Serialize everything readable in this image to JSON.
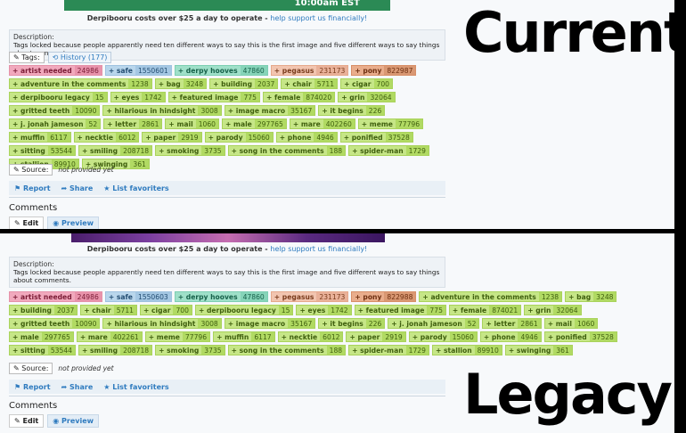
{
  "labels": {
    "current": "Current",
    "legacy": "Legacy"
  },
  "banner_text": "10:00am EST",
  "funding": {
    "prefix": "Derpibooru costs over $25 a day to operate - ",
    "link": "help support us financially!"
  },
  "description": {
    "title": "Description:",
    "text": "Tags locked because people apparently need ten different ways to say this is the first image and five different ways to say things about comments."
  },
  "tags_header": {
    "label": "Tags:",
    "history": "History (177)"
  },
  "current_tags": [
    {
      "name": "artist needed",
      "count": "24986",
      "kind": "pink"
    },
    {
      "name": "safe",
      "count": "1550601",
      "kind": "blue"
    },
    {
      "name": "derpy hooves",
      "count": "47860",
      "kind": "teal"
    },
    {
      "name": "pegasus",
      "count": "231173",
      "kind": "salmon"
    },
    {
      "name": "pony",
      "count": "822987",
      "kind": "brown"
    },
    {
      "name": "adventure in the comments",
      "count": "1238",
      "kind": "green"
    },
    {
      "name": "bag",
      "count": "3248",
      "kind": "green"
    },
    {
      "name": "building",
      "count": "2037",
      "kind": "green"
    },
    {
      "name": "chair",
      "count": "5711",
      "kind": "green"
    },
    {
      "name": "cigar",
      "count": "700",
      "kind": "green"
    },
    {
      "name": "derpibooru legacy",
      "count": "15",
      "kind": "green"
    },
    {
      "name": "eyes",
      "count": "1742",
      "kind": "green"
    },
    {
      "name": "featured image",
      "count": "775",
      "kind": "green"
    },
    {
      "name": "female",
      "count": "874020",
      "kind": "green"
    },
    {
      "name": "grin",
      "count": "32064",
      "kind": "green"
    },
    {
      "name": "gritted teeth",
      "count": "10090",
      "kind": "green"
    },
    {
      "name": "hilarious in hindsight",
      "count": "3008",
      "kind": "green"
    },
    {
      "name": "image macro",
      "count": "35167",
      "kind": "green"
    },
    {
      "name": "it begins",
      "count": "226",
      "kind": "green"
    },
    {
      "name": "j. jonah jameson",
      "count": "52",
      "kind": "green"
    },
    {
      "name": "letter",
      "count": "2861",
      "kind": "green"
    },
    {
      "name": "mail",
      "count": "1060",
      "kind": "green"
    },
    {
      "name": "male",
      "count": "297765",
      "kind": "green"
    },
    {
      "name": "mare",
      "count": "402260",
      "kind": "green"
    },
    {
      "name": "meme",
      "count": "77796",
      "kind": "green"
    },
    {
      "name": "muffin",
      "count": "6117",
      "kind": "green"
    },
    {
      "name": "necktie",
      "count": "6012",
      "kind": "green"
    },
    {
      "name": "paper",
      "count": "2919",
      "kind": "green"
    },
    {
      "name": "parody",
      "count": "15060",
      "kind": "green"
    },
    {
      "name": "phone",
      "count": "4946",
      "kind": "green"
    },
    {
      "name": "ponified",
      "count": "37528",
      "kind": "green"
    },
    {
      "name": "sitting",
      "count": "53544",
      "kind": "green"
    },
    {
      "name": "smiling",
      "count": "208718",
      "kind": "green"
    },
    {
      "name": "smoking",
      "count": "3735",
      "kind": "green"
    },
    {
      "name": "song in the comments",
      "count": "188",
      "kind": "green"
    },
    {
      "name": "spider-man",
      "count": "1729",
      "kind": "green"
    },
    {
      "name": "stallion",
      "count": "89910",
      "kind": "green"
    },
    {
      "name": "swinging",
      "count": "361",
      "kind": "green"
    }
  ],
  "legacy_tags": [
    {
      "name": "artist needed",
      "count": "24986",
      "kind": "pink"
    },
    {
      "name": "safe",
      "count": "1550603",
      "kind": "blue"
    },
    {
      "name": "derpy hooves",
      "count": "47860",
      "kind": "teal"
    },
    {
      "name": "pegasus",
      "count": "231173",
      "kind": "salmon"
    },
    {
      "name": "pony",
      "count": "822988",
      "kind": "brown"
    },
    {
      "name": "adventure in the comments",
      "count": "1238",
      "kind": "green"
    },
    {
      "name": "bag",
      "count": "3248",
      "kind": "green"
    },
    {
      "name": "building",
      "count": "2037",
      "kind": "green"
    },
    {
      "name": "chair",
      "count": "5711",
      "kind": "green"
    },
    {
      "name": "cigar",
      "count": "700",
      "kind": "green"
    },
    {
      "name": "derpibooru legacy",
      "count": "15",
      "kind": "green"
    },
    {
      "name": "eyes",
      "count": "1742",
      "kind": "green"
    },
    {
      "name": "featured image",
      "count": "775",
      "kind": "green"
    },
    {
      "name": "female",
      "count": "874021",
      "kind": "green"
    },
    {
      "name": "grin",
      "count": "32064",
      "kind": "green"
    },
    {
      "name": "gritted teeth",
      "count": "10090",
      "kind": "green"
    },
    {
      "name": "hilarious in hindsight",
      "count": "3008",
      "kind": "green"
    },
    {
      "name": "image macro",
      "count": "35167",
      "kind": "green"
    },
    {
      "name": "it begins",
      "count": "226",
      "kind": "green"
    },
    {
      "name": "j. jonah jameson",
      "count": "52",
      "kind": "green"
    },
    {
      "name": "letter",
      "count": "2861",
      "kind": "green"
    },
    {
      "name": "mail",
      "count": "1060",
      "kind": "green"
    },
    {
      "name": "male",
      "count": "297765",
      "kind": "green"
    },
    {
      "name": "mare",
      "count": "402261",
      "kind": "green"
    },
    {
      "name": "meme",
      "count": "77796",
      "kind": "green"
    },
    {
      "name": "muffin",
      "count": "6117",
      "kind": "green"
    },
    {
      "name": "necktie",
      "count": "6012",
      "kind": "green"
    },
    {
      "name": "paper",
      "count": "2919",
      "kind": "green"
    },
    {
      "name": "parody",
      "count": "15060",
      "kind": "green"
    },
    {
      "name": "phone",
      "count": "4946",
      "kind": "green"
    },
    {
      "name": "ponified",
      "count": "37528",
      "kind": "green"
    },
    {
      "name": "sitting",
      "count": "53544",
      "kind": "green"
    },
    {
      "name": "smiling",
      "count": "208718",
      "kind": "green"
    },
    {
      "name": "smoking",
      "count": "3735",
      "kind": "green"
    },
    {
      "name": "song in the comments",
      "count": "188",
      "kind": "green"
    },
    {
      "name": "spider-man",
      "count": "1729",
      "kind": "green"
    },
    {
      "name": "stallion",
      "count": "89910",
      "kind": "green"
    },
    {
      "name": "swinging",
      "count": "361",
      "kind": "green"
    }
  ],
  "source": {
    "label": "Source:",
    "value": "not provided yet"
  },
  "actions": {
    "report": "Report",
    "share": "Share",
    "favorites": "List favoriters"
  },
  "comments": {
    "title": "Comments",
    "edit": "Edit",
    "preview": "Preview"
  }
}
